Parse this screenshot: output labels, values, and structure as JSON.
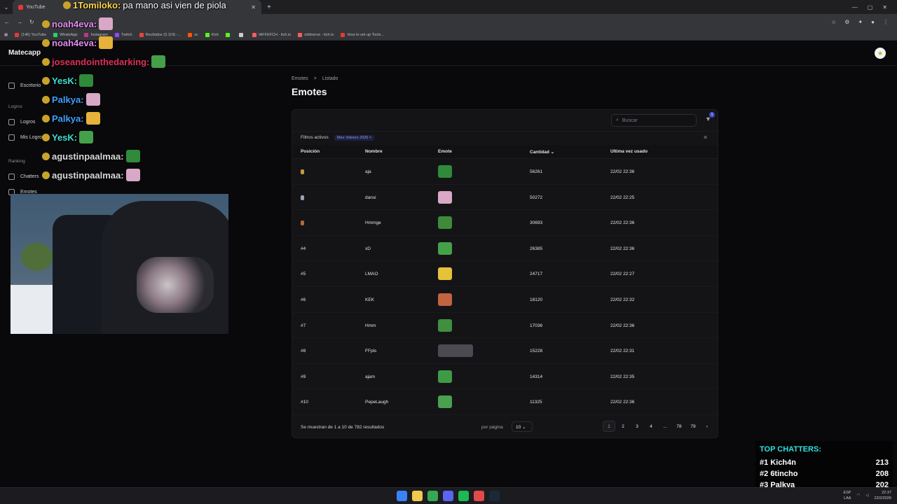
{
  "browser": {
    "tab_title": "YouTube",
    "bookmarks": [
      {
        "label": "(146) YouTube",
        "color": "#e53935"
      },
      {
        "label": "WhatsApp",
        "color": "#25d366"
      },
      {
        "label": "Instagram",
        "color": "#c13584"
      },
      {
        "label": "Twitch",
        "color": "#9146ff"
      },
      {
        "label": "Recibidos (3.119) -...",
        "color": "#ea4335"
      },
      {
        "label": "sc",
        "color": "#ff5500"
      },
      {
        "label": "Kick",
        "color": "#53fc18"
      },
      {
        "label": "",
        "color": "#53fc18"
      },
      {
        "label": "",
        "color": "#cccccc"
      },
      {
        "label": "IAFFEFCH - itch.io",
        "color": "#fa5c5c"
      },
      {
        "label": "oddnerve - itch.io",
        "color": "#fa5c5c"
      },
      {
        "label": "How to set up Tools...",
        "color": "#e53935"
      }
    ]
  },
  "app": {
    "brand": "Matecapp",
    "sidebar": {
      "escritorio": "Escritorio",
      "section_logros": "Logros",
      "logros": "Logros",
      "mis_logros": "Mis Logros",
      "section_ranking": "Ranking",
      "chatters": "Chatters",
      "emotes": "Emotes"
    },
    "breadcrumb": {
      "root": "Emotes",
      "sep": ">",
      "current": "Listado"
    },
    "page_title": "Emotes",
    "search": {
      "placeholder": "Buscar"
    },
    "filter_count": "1",
    "filters": {
      "label": "Filtros activos",
      "chip": "Mes: febrero 2026 ×"
    },
    "columns": {
      "position": "Posición",
      "name": "Nombre",
      "emote": "Emote",
      "quantity": "Cantidad ⌄",
      "last_used": "Ultima vez usado"
    },
    "rows": [
      {
        "position": "",
        "medal": "#c99a3a",
        "name": "aja",
        "emote_color": "#2f8a3a",
        "quantity": "56261",
        "last_used": "22/02 22:36"
      },
      {
        "position": "",
        "medal": "#9aa4b8",
        "name": "dansi",
        "emote_color": "#d9a8c6",
        "quantity": "50272",
        "last_used": "22/02 22:25"
      },
      {
        "position": "",
        "medal": "#b06a3a",
        "name": "Hmmge",
        "emote_color": "#3f8a3a",
        "quantity": "30693",
        "last_used": "22/02 22:36"
      },
      {
        "position": "#4",
        "name": "xD",
        "emote_color": "#45a04a",
        "quantity": "26385",
        "last_used": "22/02 22:36"
      },
      {
        "position": "#5",
        "name": "LMAO",
        "emote_color": "#e6c23a",
        "quantity": "24717",
        "last_used": "22/02 22:27"
      },
      {
        "position": "#6",
        "name": "KEK",
        "emote_color": "#c2643f",
        "quantity": "18120",
        "last_used": "22/02 22:32"
      },
      {
        "position": "#7",
        "name": "Hmm",
        "emote_color": "#3f8f3f",
        "quantity": "17036",
        "last_used": "22/02 22:36"
      },
      {
        "position": "#8",
        "name": "FFpls",
        "emote_color": "#4a4a50",
        "quantity": "15228",
        "last_used": "22/02 22:31"
      },
      {
        "position": "#9",
        "name": "ajam",
        "emote_color": "#3f9a45",
        "quantity": "14314",
        "last_used": "22/02 22:35"
      },
      {
        "position": "#10",
        "name": "PepeLaugh",
        "emote_color": "#4aa04f",
        "quantity": "11325",
        "last_used": "22/02 22:36"
      }
    ],
    "footer": {
      "summary": "Se muestran de 1 a 10 de 782 resultados",
      "per_page_label": "por página",
      "per_page_value": "10 ⌄",
      "pages": [
        "1",
        "2",
        "3",
        "4",
        "...",
        "78",
        "79",
        "›"
      ]
    }
  },
  "overlay_chat": [
    {
      "user": "1Tomiloko:",
      "msg": "pa mano asi vien de piola",
      "color": "#ffd84a"
    },
    {
      "user": "noah4eva:",
      "msg": "",
      "color": "#e58cf2"
    },
    {
      "user": "noah4eva:",
      "msg": "",
      "color": "#e58cf2"
    },
    {
      "user": "joseandointhedarking:",
      "msg": "",
      "color": "#e0305a"
    },
    {
      "user": "YesK:",
      "msg": "",
      "color": "#3fe0d0"
    },
    {
      "user": "Palkya:",
      "msg": "",
      "color": "#3fa0ff"
    },
    {
      "user": "Palkya:",
      "msg": "",
      "color": "#3fa0ff"
    },
    {
      "user": "YesK:",
      "msg": "",
      "color": "#3fe0d0"
    },
    {
      "user": "agustinpaalmaa:",
      "msg": "",
      "color": "#d8d8d8"
    },
    {
      "user": "agustinpaalmaa:",
      "msg": "",
      "color": "#d8d8d8"
    }
  ],
  "top_chatters": {
    "title": "TOP CHATTERS:",
    "entries": [
      {
        "rank": "#1",
        "name": "Kich4n",
        "count": "213"
      },
      {
        "rank": "#2",
        "name": "6tincho",
        "count": "208"
      },
      {
        "rank": "#3",
        "name": "Palkya",
        "count": "202"
      }
    ]
  },
  "taskbar": {
    "lang_top": "ESP",
    "lang_bottom": "LAA",
    "time": "22:37",
    "date": "22/2/2026",
    "icon_colors": [
      "#3b82f6",
      "#f2c94c",
      "#34a853",
      "#5865f2",
      "#1db954",
      "#e24a4a",
      "#1b2838"
    ]
  }
}
